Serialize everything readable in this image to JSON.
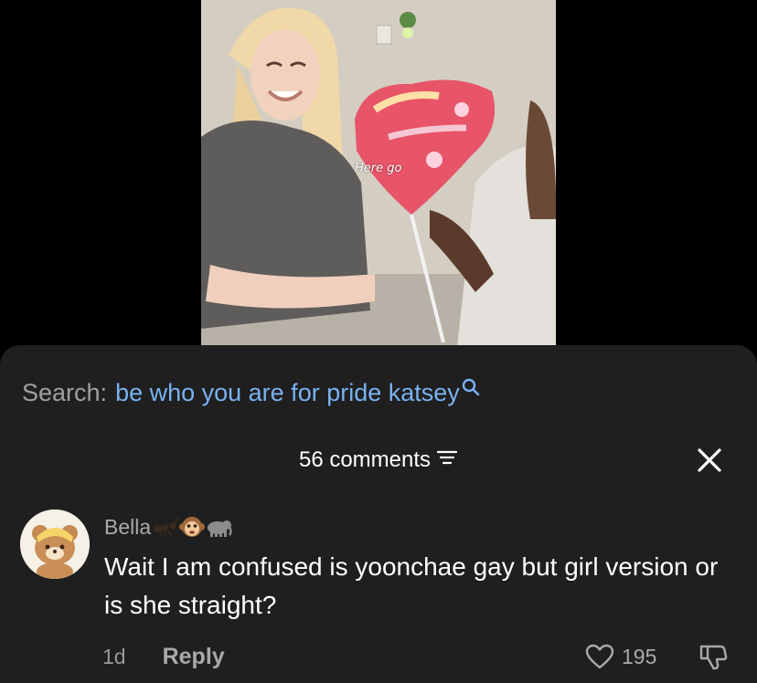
{
  "video": {
    "caption": "Here go"
  },
  "search": {
    "prefix": "Search:",
    "query": "be who you are for pride katsey",
    "icon": "search-icon"
  },
  "comments": {
    "count_label": "56 comments",
    "sort_icon": "sort-icon",
    "close_icon": "close-icon"
  },
  "comment": {
    "author": "Bella",
    "author_emojis": [
      "ant-emoji",
      "monkey-face-emoji",
      "elephant-emoji"
    ],
    "text": "Wait I am confused is yoonchae gay but girl version or is she straight?",
    "time": "1d",
    "reply_label": "Reply",
    "likes": "195",
    "like_icon": "heart-icon",
    "dislike_icon": "thumbs-down-icon"
  },
  "colors": {
    "sheet_background": "#1f1f1f",
    "search_query": "#7ab2f2",
    "muted_text": "#a9a9a9"
  }
}
